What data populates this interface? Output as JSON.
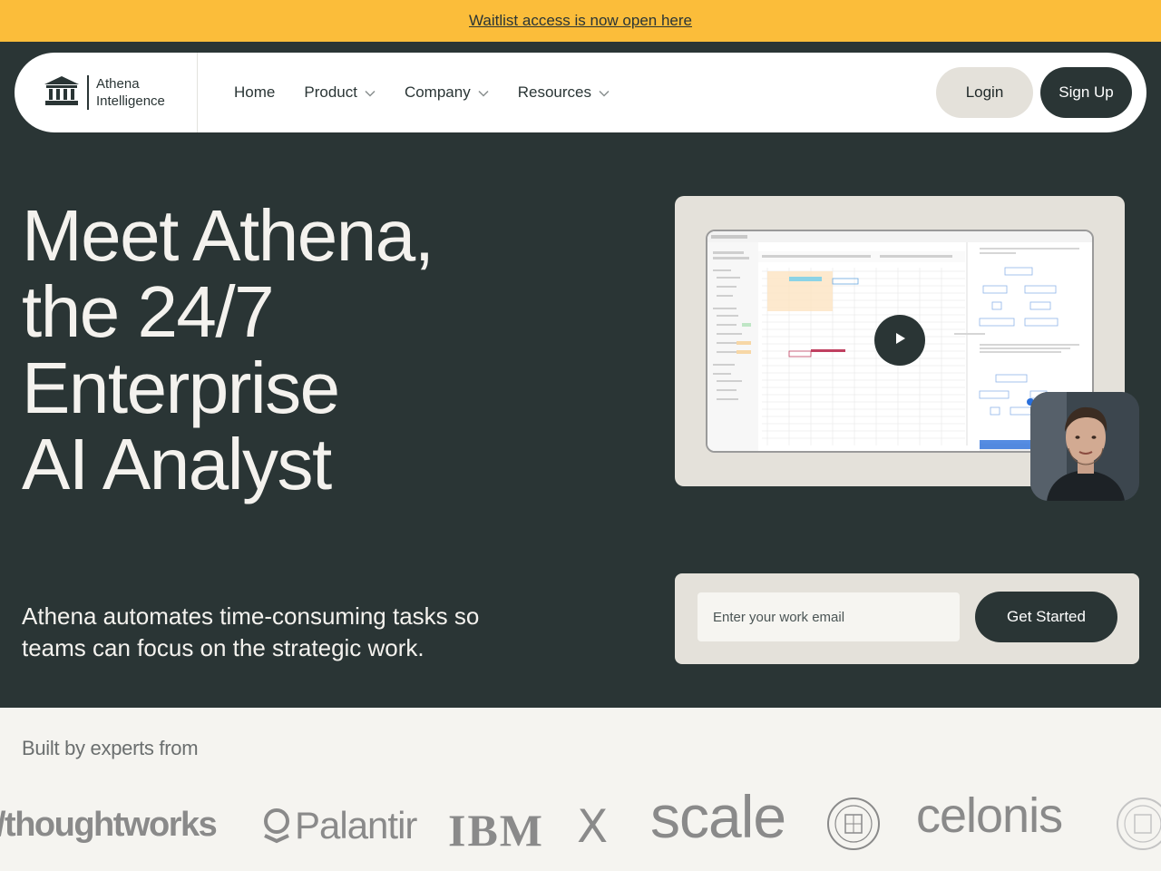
{
  "banner": {
    "text": "Waitlist access is now open here"
  },
  "brand": {
    "line1": "Athena",
    "line2": "Intelligence",
    "logo_icon": "bank-icon"
  },
  "nav": {
    "home": "Home",
    "product": "Product",
    "company": "Company",
    "resources": "Resources"
  },
  "auth": {
    "login": "Login",
    "signup": "Sign Up"
  },
  "hero": {
    "title_lines": [
      "Meet Athena,",
      "the 24/7",
      "Enterprise",
      "AI Analyst"
    ],
    "subtitle": "Athena automates time-consuming tasks so teams can focus on the strategic work."
  },
  "signup_form": {
    "email_placeholder": "Enter your work email",
    "cta": "Get Started"
  },
  "partners": {
    "heading": "Built by experts from",
    "logos": [
      "/thoughtworks",
      "Palantir",
      "IBM",
      "X",
      "scale",
      "Cornell University",
      "celonis"
    ]
  },
  "colors": {
    "banner": "#fbbd3a",
    "dark": "#2a3535",
    "light": "#f5f4f0",
    "card": "#e4e1da"
  }
}
